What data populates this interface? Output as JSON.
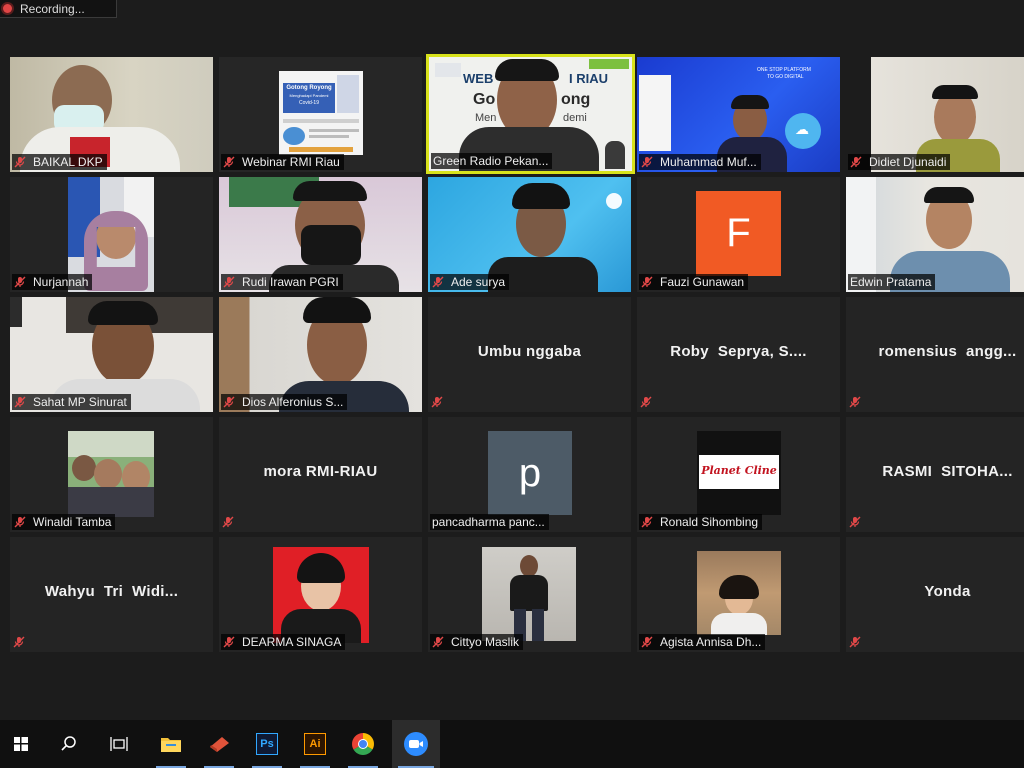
{
  "recording": {
    "label": "Recording..."
  },
  "participants": [
    {
      "name": "BAIKAL DKP",
      "muted": true,
      "video": true
    },
    {
      "name": "Webinar RMI Riau",
      "muted": true,
      "video": true
    },
    {
      "name": "Green Radio Pekan...",
      "muted": false,
      "video": true,
      "speaking": true
    },
    {
      "name": "Muhammad Muf...",
      "muted": true,
      "video": true
    },
    {
      "name": "Didiet Djunaidi",
      "muted": true,
      "video": true
    },
    {
      "name": "Nurjannah",
      "muted": true,
      "video": true
    },
    {
      "name": "Rudi Irawan PGRI",
      "muted": true,
      "video": true
    },
    {
      "name": "Ade surya",
      "muted": true,
      "video": true
    },
    {
      "name": "Fauzi Gunawan",
      "muted": true,
      "video": false,
      "avatar_letter": "F",
      "avatar_color": "#f15a24"
    },
    {
      "name": "Edwin Pratama",
      "muted": false,
      "video": true
    },
    {
      "name": "Sahat MP Sinurat",
      "muted": true,
      "video": true
    },
    {
      "name": "Dios Alferonius S...",
      "muted": true,
      "video": true
    },
    {
      "name": "Umbu nggaba",
      "muted": true,
      "video": false
    },
    {
      "name": "Roby  Seprya, S....",
      "muted": true,
      "video": false
    },
    {
      "name": "romensius  angg...",
      "muted": true,
      "video": false
    },
    {
      "name": "Winaldi Tamba",
      "muted": true,
      "video": true
    },
    {
      "name": "mora RMI-RIAU",
      "muted": true,
      "video": false
    },
    {
      "name": "pancadharma panc...",
      "muted": false,
      "video": false,
      "avatar_letter": "p",
      "avatar_color": "#4d5b67"
    },
    {
      "name": "Ronald Sihombing",
      "muted": true,
      "video": true,
      "logo_text": "Planet Cline"
    },
    {
      "name": "RASMI  SITOHA...",
      "muted": true,
      "video": false
    },
    {
      "name": "Wahyu  Tri  Widi...",
      "muted": true,
      "video": false
    },
    {
      "name": "DEARMA SINAGA",
      "muted": true,
      "video": true
    },
    {
      "name": "Cittyo Maslik",
      "muted": true,
      "video": true
    },
    {
      "name": "Agista Annisa Dh...",
      "muted": true,
      "video": true
    },
    {
      "name": "Yonda",
      "muted": true,
      "video": false
    }
  ],
  "slide": {
    "line1": "WEB",
    "line1b": "I RIAU",
    "line2": "Go",
    "line2b": "ong",
    "line3": "Men",
    "line3b": "demi"
  },
  "webinar_poster": {
    "title": "Gotong Royong",
    "subtitle": "Menghadapi Pandemi",
    "covid": "Covid-19"
  },
  "promo": {
    "line1": "ONE STOP PLATFORM",
    "line2": "TO GO DIGITAL"
  },
  "taskbar": {
    "items": [
      "windows-start",
      "search",
      "task-view",
      "file-explorer",
      "app-red",
      "photoshop",
      "illustrator",
      "chrome",
      "zoom"
    ],
    "ps_label": "Ps",
    "ai_label": "Ai",
    "accent": "#7aa7e0"
  }
}
